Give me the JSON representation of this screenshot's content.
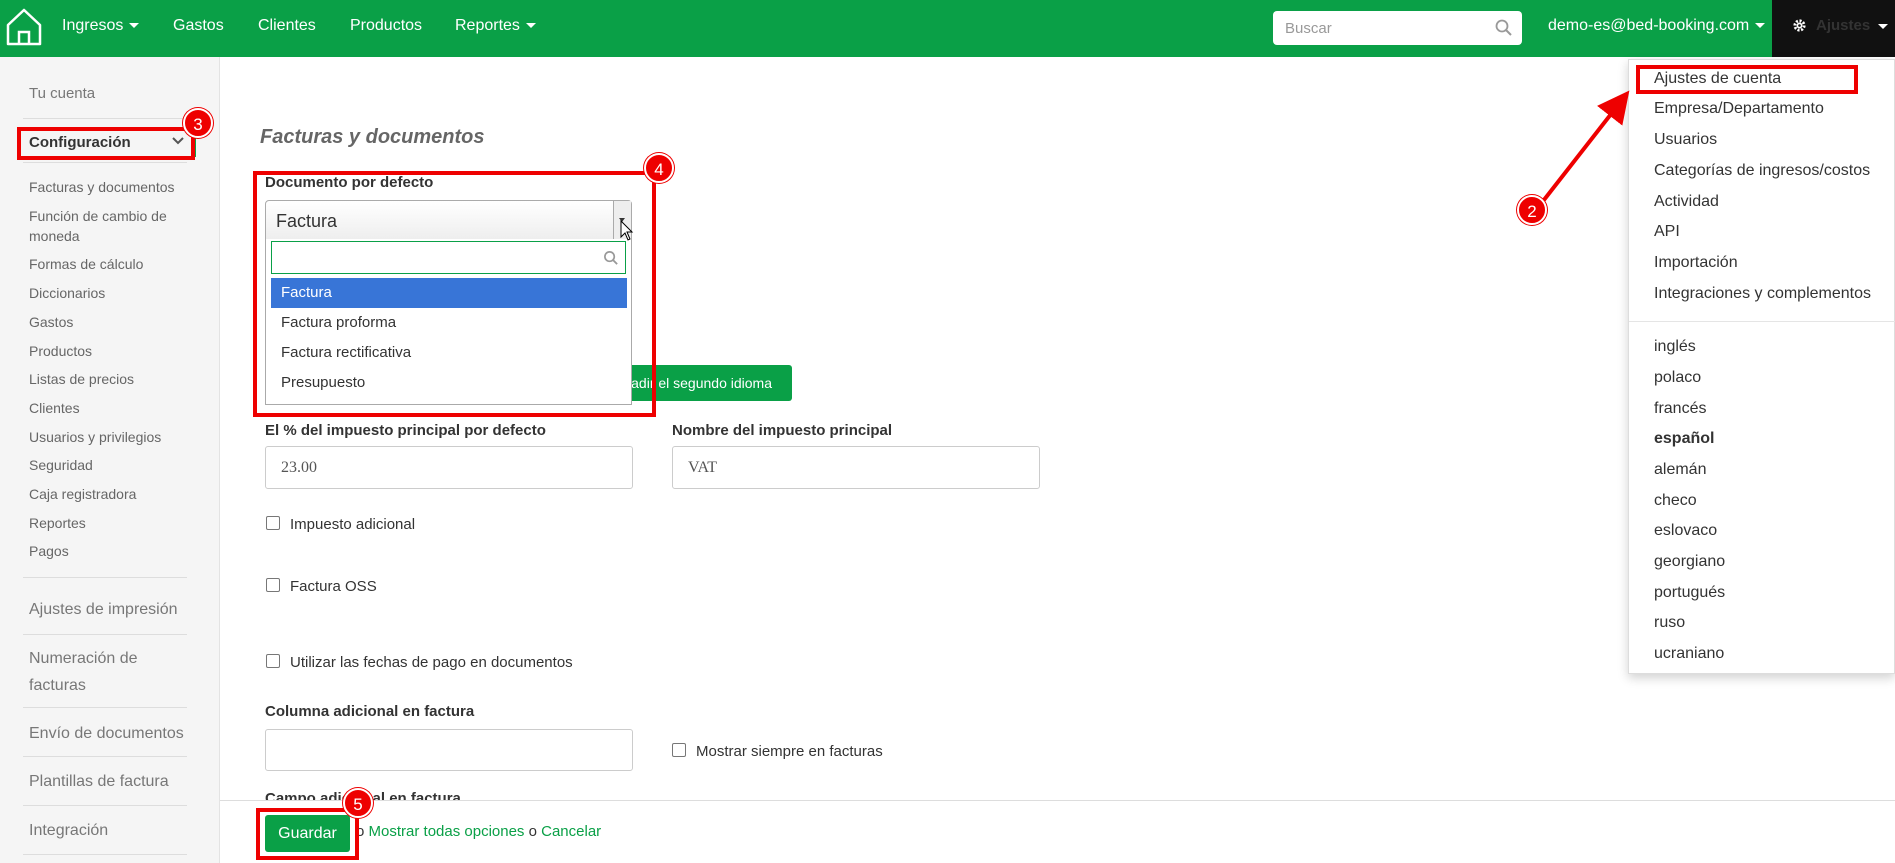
{
  "nav": {
    "items": [
      "Ingresos",
      "Gastos",
      "Clientes",
      "Productos",
      "Reportes"
    ],
    "search_placeholder": "Buscar",
    "user_email": "demo-es@bed-booking.com",
    "settings_label": "Ajustes"
  },
  "sidebar": {
    "account": "Tu cuenta",
    "configuration": "Configuración",
    "sub_items": [
      "Facturas y documentos",
      "Función de cambio de moneda",
      "Formas de cálculo",
      "Diccionarios",
      "Gastos",
      "Productos",
      "Listas de precios",
      "Clientes",
      "Usuarios y privilegios",
      "Seguridad",
      "Caja registradora",
      "Reportes",
      "Pagos"
    ],
    "sections": [
      "Ajustes de impresión",
      "Numeración de facturas",
      "Envío de documentos",
      "Plantillas de factura",
      "Integración"
    ]
  },
  "main": {
    "title": "Facturas y documentos",
    "default_doc_label": "Documento por defecto",
    "default_doc_value": "Factura",
    "doc_options": [
      "Factura",
      "Factura proforma",
      "Factura rectificativa",
      "Presupuesto"
    ],
    "second_language_btn": "ñadir el segundo idioma",
    "tax_percent_label": "El % del impuesto principal por defecto",
    "tax_percent_value": "23.00",
    "tax_name_label": "Nombre del impuesto principal",
    "tax_name_value": "VAT",
    "additional_tax": "Impuesto adicional",
    "oss_invoice": "Factura OSS",
    "payment_dates": "Utilizar las fechas de pago en documentos",
    "extra_column_label": "Columna adicional en factura",
    "extra_column_value": "",
    "always_show": "Mostrar siempre en facturas",
    "extra_field_label": "Campo adicional en factura"
  },
  "bottom": {
    "save": "Guardar",
    "or1": "o",
    "show_all": "Mostrar todas opciones",
    "or2": "o",
    "cancel": "Cancelar"
  },
  "settings_menu": {
    "items": [
      "Ajustes de cuenta",
      "Empresa/Departamento",
      "Usuarios",
      "Categorías de ingresos/costos",
      "Actividad",
      "API",
      "Importación",
      "Integraciones y complementos"
    ],
    "languages": [
      "inglés",
      "polaco",
      "francés",
      "español",
      "alemán",
      "checo",
      "eslovaco",
      "georgiano",
      "portugués",
      "ruso",
      "ucraniano"
    ],
    "current_language": "español"
  },
  "annotations": [
    "2",
    "3",
    "4",
    "5"
  ],
  "colors": {
    "brand": "#0aa047",
    "annotation": "#e00000",
    "selected_option": "#3875d7"
  }
}
